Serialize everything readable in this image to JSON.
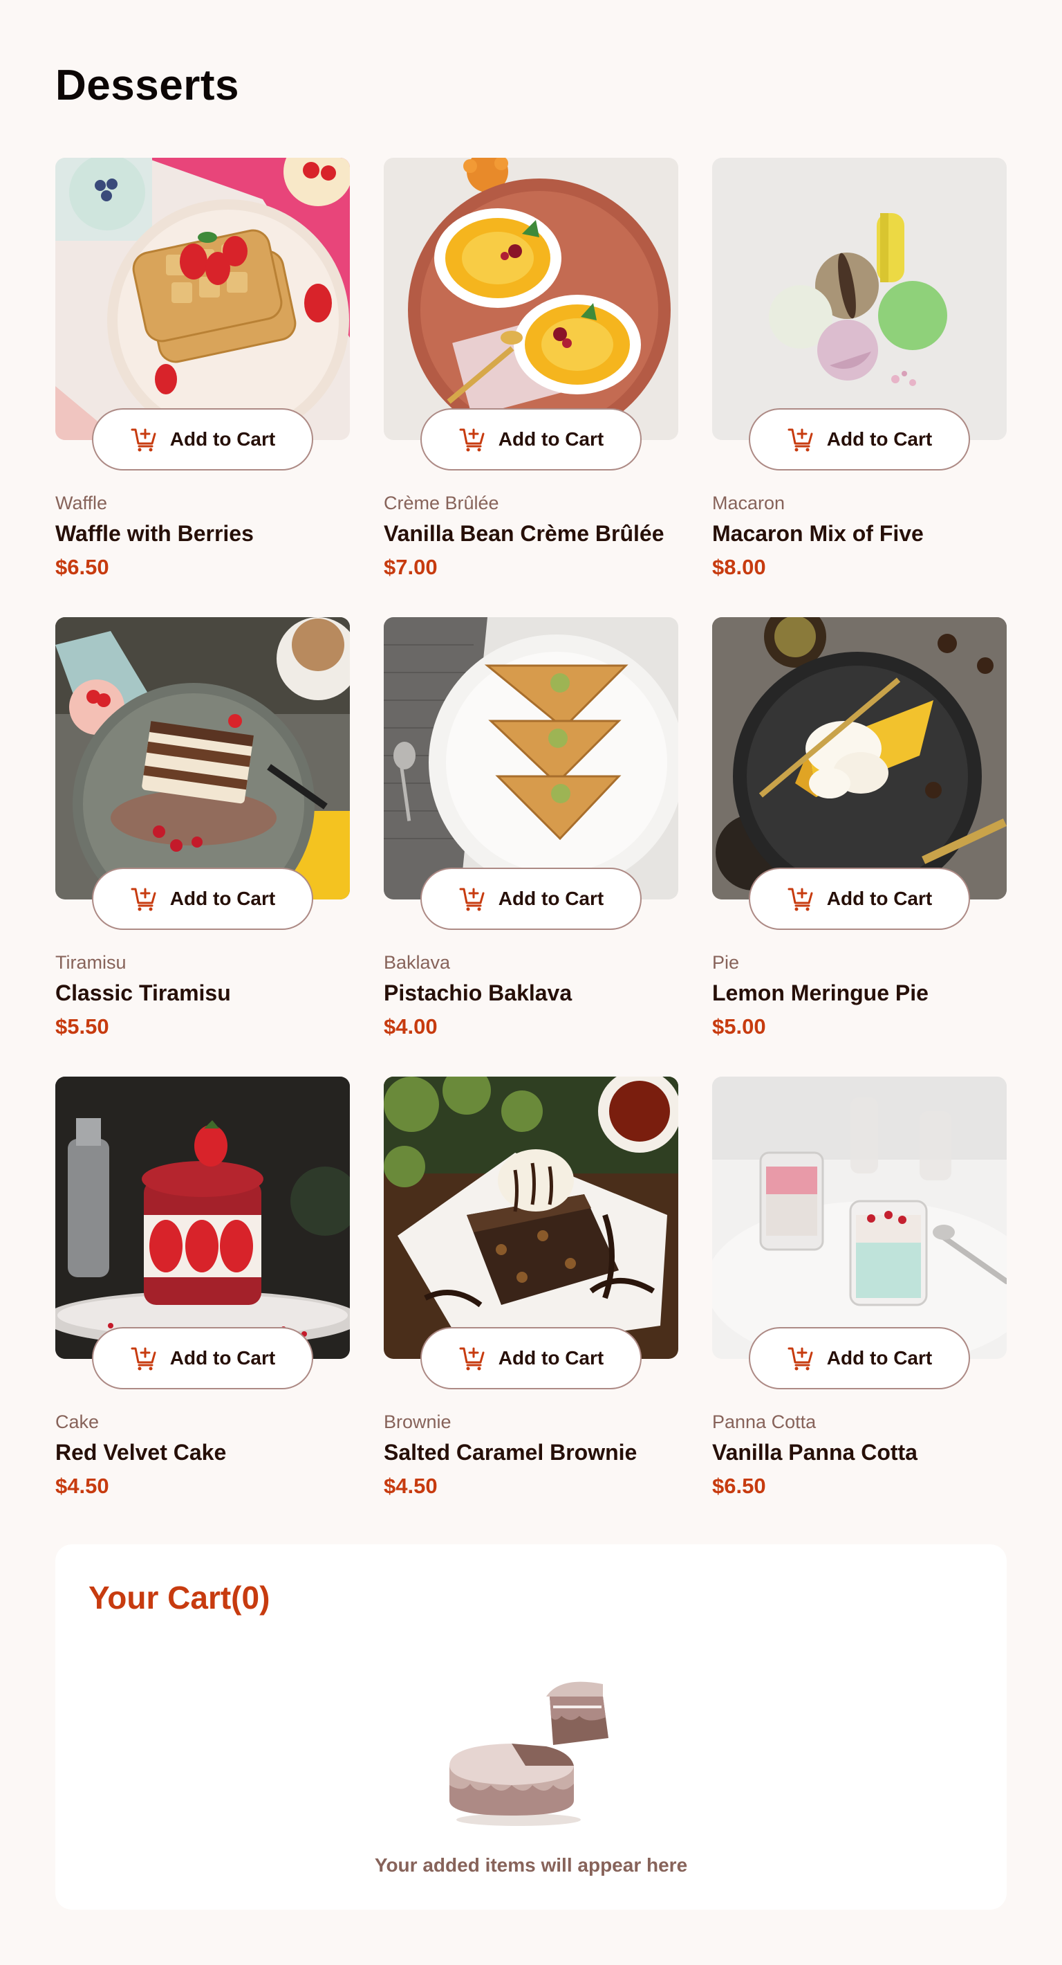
{
  "page": {
    "title": "Desserts"
  },
  "products": [
    {
      "category": "Waffle",
      "name": "Waffle with Berries",
      "price": "$6.50",
      "button": "Add to Cart"
    },
    {
      "category": "Crème Brûlée",
      "name": "Vanilla Bean Crème Brûlée",
      "price": "$7.00",
      "button": "Add to Cart"
    },
    {
      "category": "Macaron",
      "name": "Macaron Mix of Five",
      "price": "$8.00",
      "button": "Add to Cart"
    },
    {
      "category": "Tiramisu",
      "name": "Classic Tiramisu",
      "price": "$5.50",
      "button": "Add to Cart"
    },
    {
      "category": "Baklava",
      "name": "Pistachio Baklava",
      "price": "$4.00",
      "button": "Add to Cart"
    },
    {
      "category": "Pie",
      "name": "Lemon Meringue Pie",
      "price": "$5.00",
      "button": "Add to Cart"
    },
    {
      "category": "Cake",
      "name": "Red Velvet Cake",
      "price": "$4.50",
      "button": "Add to Cart"
    },
    {
      "category": "Brownie",
      "name": "Salted Caramel Brownie",
      "price": "$4.50",
      "button": "Add to Cart"
    },
    {
      "category": "Panna Cotta",
      "name": "Vanilla Panna Cotta",
      "price": "$6.50",
      "button": "Add to Cart"
    }
  ],
  "cart": {
    "title": "Your Cart(0)",
    "empty_message": "Your added items will appear here"
  },
  "colors": {
    "accent": "#c73b0f",
    "background": "#fcf8f6",
    "text_dark": "#260f08",
    "text_muted": "#87635a",
    "button_border": "#ad8a85"
  },
  "icons": {
    "add_to_cart": "add-to-cart-icon",
    "empty_cart": "empty-cake-illustration"
  }
}
